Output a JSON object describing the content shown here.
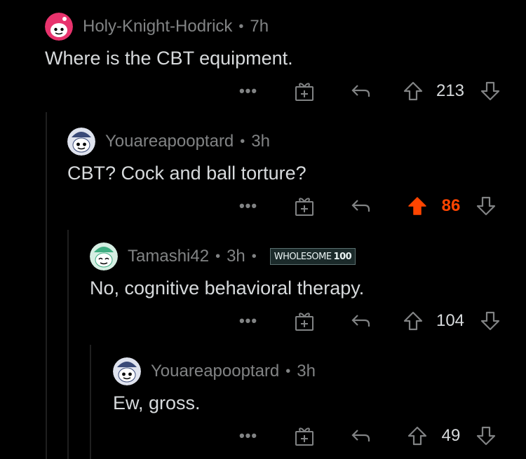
{
  "comments": [
    {
      "author": "Holy-Knight-Hodrick",
      "age": "7h",
      "text": "Where is the CBT equipment.",
      "score": "213",
      "upvoted": false,
      "award": null,
      "avatar_color": "#e8336d"
    },
    {
      "author": "Youareapooptard",
      "age": "3h",
      "text": "CBT? Cock and ball torture?",
      "score": "86",
      "upvoted": true,
      "award": null,
      "avatar_color": "#5b6b8f"
    },
    {
      "author": "Tamashi42",
      "age": "3h",
      "text": "No, cognitive behavioral therapy.",
      "score": "104",
      "upvoted": false,
      "award": {
        "label": "WHOLESOME",
        "count": "100"
      },
      "avatar_color": "#3fae82"
    },
    {
      "author": "Youareapooptard",
      "age": "3h",
      "text": "Ew, gross.",
      "score": "49",
      "upvoted": false,
      "award": null,
      "avatar_color": "#5b6b8f"
    }
  ],
  "meta_separator": "•",
  "more_label": "•••",
  "colors": {
    "upvote_active": "#ff4500",
    "muted": "#818384",
    "text": "#d7dadc",
    "background": "#000000"
  },
  "icons": [
    "more-options-icon",
    "give-award-icon",
    "reply-icon",
    "upvote-icon",
    "downvote-icon"
  ]
}
